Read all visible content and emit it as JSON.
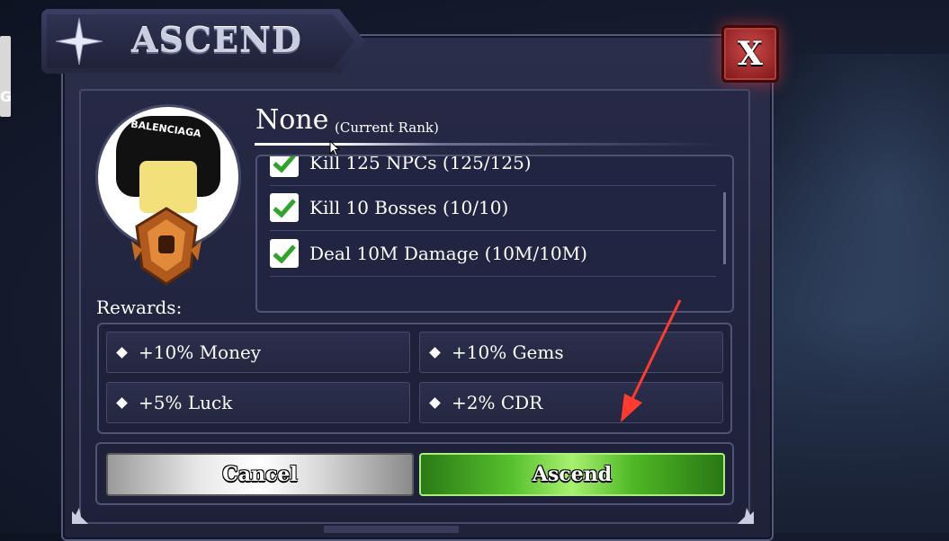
{
  "title": "ASCEND",
  "close_label": "X",
  "edge_letter": "G",
  "avatar_cap_text": "BALENCIAGA",
  "rank": {
    "name": "None",
    "sub": "(Current Rank)"
  },
  "requirements": [
    {
      "text": "Kill 125 NPCs (125/125)",
      "done": true
    },
    {
      "text": "Kill 10 Bosses (10/10)",
      "done": true
    },
    {
      "text": "Deal 10M Damage (10M/10M)",
      "done": true
    }
  ],
  "rewards_label": "Rewards:",
  "rewards": [
    "+10% Money",
    "+10% Gems",
    "+5% Luck",
    "+2% CDR"
  ],
  "buttons": {
    "cancel": "Cancel",
    "ascend": "Ascend"
  },
  "colors": {
    "ascend_green": "#56c02d",
    "close_red": "#b83a3a",
    "annotation_arrow": "#ff3b30"
  }
}
